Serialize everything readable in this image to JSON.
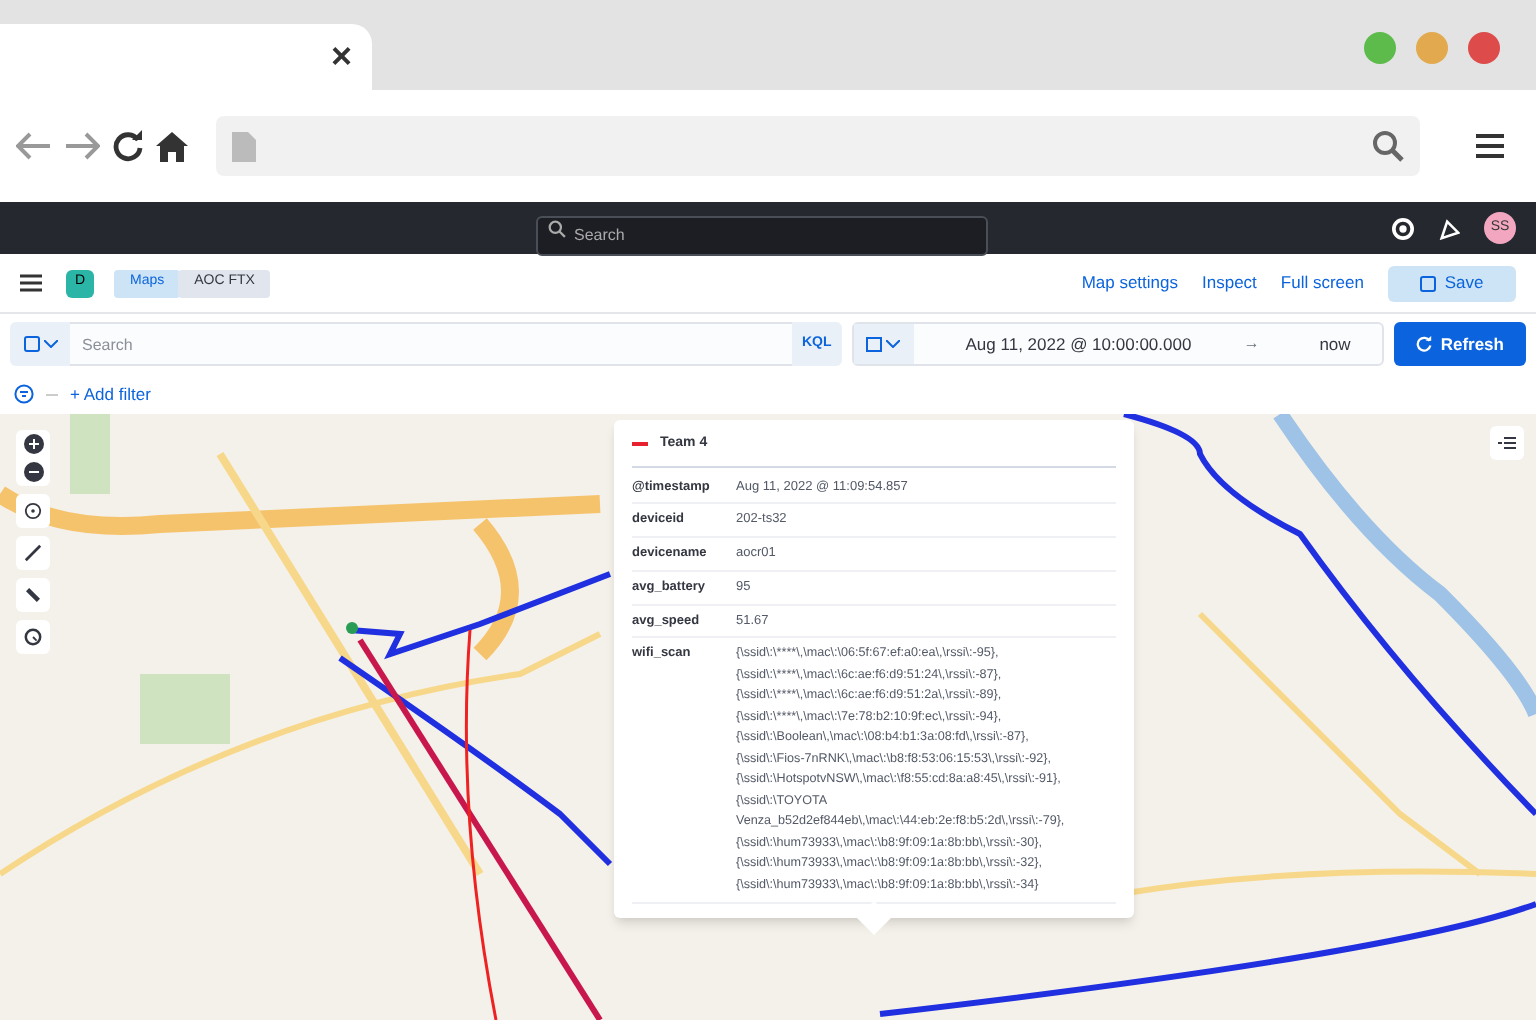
{
  "browser": {
    "tab_close": "×"
  },
  "header": {
    "search_placeholder": "Search",
    "avatar": "SS"
  },
  "app_bar": {
    "space_badge": "D",
    "breadcrumbs": [
      {
        "label": "Maps",
        "selected": false
      },
      {
        "label": "AOC FTX",
        "selected": true
      }
    ],
    "links": [
      "Map settings",
      "Inspect",
      "Full screen"
    ],
    "save_button": "Save"
  },
  "query_bar": {
    "search_placeholder": "Search",
    "language": "KQL",
    "start": "Aug 11, 2022 @ 10:00:00.000",
    "arrow": "→",
    "end": "now",
    "refresh_button": "Refresh"
  },
  "filter_bar": {
    "add_filter": "+ Add filter"
  },
  "popup": {
    "title": "Team 4",
    "color": "#e7222e",
    "rows": [
      {
        "key": "@timestamp",
        "value": "Aug 11, 2022 @ 11:09:54.857"
      },
      {
        "key": "deviceid",
        "value": "202-ts32"
      },
      {
        "key": "devicename",
        "value": "aocr01"
      },
      {
        "key": "avg_battery",
        "value": "95"
      },
      {
        "key": "avg_speed",
        "value": "51.67"
      },
      {
        "key": "wifi_scan",
        "lines": [
          "{\\ssid\\:\\****\\,\\mac\\:\\06:5f:67:ef:a0:ea\\,\\rssi\\:-95},",
          "{\\ssid\\:\\****\\,\\mac\\:\\6c:ae:f6:d9:51:24\\,\\rssi\\:-87},",
          "{\\ssid\\:\\****\\,\\mac\\:\\6c:ae:f6:d9:51:2a\\,\\rssi\\:-89},",
          "{\\ssid\\:\\****\\,\\mac\\:\\7e:78:b2:10:9f:ec\\,\\rssi\\:-94},",
          "{\\ssid\\:\\Boolean\\,\\mac\\:\\08:b4:b1:3a:08:fd\\,\\rssi\\:-87},",
          "{\\ssid\\:\\Fios-7nRNK\\,\\mac\\:\\b8:f8:53:06:15:53\\,\\rssi\\:-92},",
          "{\\ssid\\:\\HotspotvNSW\\,\\mac\\:\\f8:55:cd:8a:a8:45\\,\\rssi\\:-91},",
          "{\\ssid\\:\\TOYOTA",
          "Venza_b52d2ef844eb\\,\\mac\\:\\44:eb:2e:f8:b5:2d\\,\\rssi\\:-79},",
          "{\\ssid\\:\\hum73933\\,\\mac\\:\\b8:9f:09:1a:8b:bb\\,\\rssi\\:-30},",
          "{\\ssid\\:\\hum73933\\,\\mac\\:\\b8:9f:09:1a:8b:bb\\,\\rssi\\:-32},",
          "{\\ssid\\:\\hum73933\\,\\mac\\:\\b8:9f:09:1a:8b:bb\\,\\rssi\\:-34}"
        ]
      }
    ]
  }
}
